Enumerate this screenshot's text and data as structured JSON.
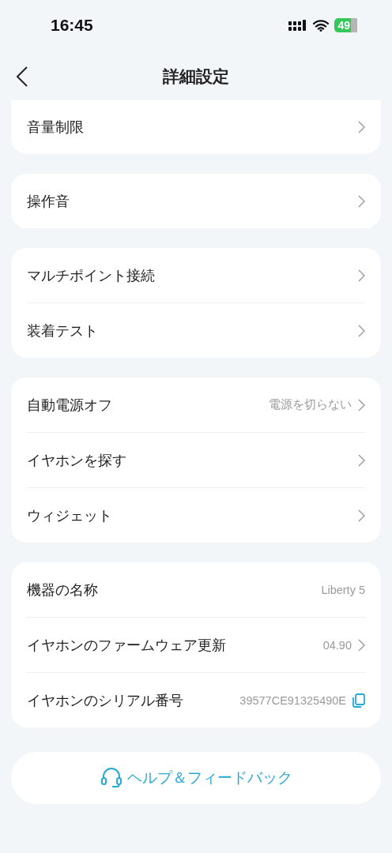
{
  "status_bar": {
    "time": "16:45",
    "battery": "49"
  },
  "nav": {
    "title": "詳細設定"
  },
  "groups": [
    {
      "cut_top": true,
      "rows": [
        {
          "label": "音量制限",
          "kind": "chevron"
        }
      ]
    },
    {
      "cut_top": false,
      "rows": [
        {
          "label": "操作音",
          "kind": "chevron"
        }
      ]
    },
    {
      "cut_top": false,
      "rows": [
        {
          "label": "マルチポイント接続",
          "kind": "chevron"
        },
        {
          "label": "装着テスト",
          "kind": "chevron"
        }
      ]
    },
    {
      "cut_top": false,
      "rows": [
        {
          "label": "自動電源オフ",
          "value": "電源を切らない",
          "kind": "chevron"
        },
        {
          "label": "イヤホンを探す",
          "kind": "chevron"
        },
        {
          "label": "ウィジェット",
          "kind": "chevron"
        }
      ]
    },
    {
      "cut_top": false,
      "rows": [
        {
          "label": "機器の名称",
          "value": "Liberty 5",
          "kind": "plain"
        },
        {
          "label": "イヤホンのファームウェア更新",
          "value": "04.90",
          "kind": "chevron"
        },
        {
          "label": "イヤホンのシリアル番号",
          "value": "39577CE91325490E",
          "kind": "copy"
        }
      ]
    }
  ],
  "help_button": {
    "label": "ヘルプ＆フィードバック"
  }
}
